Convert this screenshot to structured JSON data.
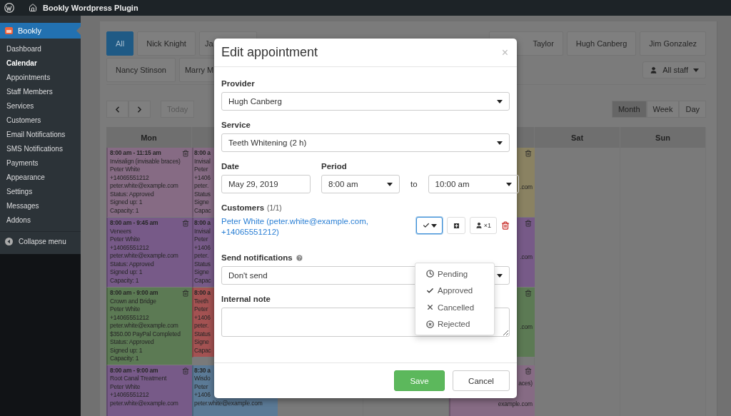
{
  "admin_bar": {
    "title": "Bookly Wordpress Plugin"
  },
  "sidebar": {
    "header": "Bookly",
    "items": [
      {
        "label": "Dashboard",
        "selected": false
      },
      {
        "label": "Calendar",
        "selected": true
      },
      {
        "label": "Appointments",
        "selected": false
      },
      {
        "label": "Staff Members",
        "selected": false
      },
      {
        "label": "Services",
        "selected": false
      },
      {
        "label": "Customers",
        "selected": false
      },
      {
        "label": "Email Notifications",
        "selected": false
      },
      {
        "label": "SMS Notifications",
        "selected": false
      },
      {
        "label": "Payments",
        "selected": false
      },
      {
        "label": "Appearance",
        "selected": false
      },
      {
        "label": "Settings",
        "selected": false
      },
      {
        "label": "Messages",
        "selected": false
      },
      {
        "label": "Addons",
        "selected": false
      }
    ],
    "collapse": "Collapse menu"
  },
  "staff_filter": {
    "rows": [
      {
        "buttons": [
          {
            "label": "All",
            "selected": true,
            "kind": "full"
          },
          {
            "label": "Nick Knight",
            "selected": false,
            "kind": "full"
          },
          {
            "label": "Ja",
            "selected": false,
            "kind": "cut_right"
          },
          {
            "label": "Taylor",
            "selected": false,
            "kind": "cut_left"
          },
          {
            "label": "Hugh Canberg",
            "selected": false,
            "kind": "full"
          },
          {
            "label": "Jim Gonzalez",
            "selected": false,
            "kind": "full"
          }
        ]
      },
      {
        "buttons": [
          {
            "label": "Nancy Stinson",
            "selected": false,
            "kind": "full"
          },
          {
            "label": "Marry M",
            "selected": false,
            "kind": "cut_right"
          }
        ]
      }
    ],
    "all_staff": "All staff"
  },
  "toolbar": {
    "today": "Today",
    "views": [
      {
        "label": "Month",
        "selected": true
      },
      {
        "label": "Week",
        "selected": false
      },
      {
        "label": "Day",
        "selected": false
      }
    ]
  },
  "calendar": {
    "columns": [
      {
        "label": "Mon",
        "events": [
          {
            "kind": "full",
            "color": "#866b84",
            "time": "8:00 am - 11:15 am",
            "lines": [
              "Invisalign (invisable braces)",
              "Peter White",
              "+14065551212",
              "peter.white@example.com",
              "Status: Approved",
              "Signed up: 1",
              "Capacity: 1"
            ]
          },
          {
            "kind": "full",
            "color": "#775a88",
            "time": "8:00 am - 9:45 am",
            "lines": [
              "Veneers",
              "Peter White",
              "+14065551212",
              "peter.white@example.com",
              "Status: Approved",
              "Signed up: 1",
              "Capacity: 1"
            ]
          },
          {
            "kind": "full",
            "color": "#5c7a54",
            "time": "8:00 am - 9:00 am",
            "lines": [
              "Crown and Bridge",
              "Peter White",
              "+14065551212",
              "peter.white@example.com",
              "$350.00 PayPal Completed",
              "Status: Approved",
              "Signed up: 1",
              "Capacity: 1"
            ]
          },
          {
            "kind": "full",
            "color": "#775a88",
            "time": "8:00 am - 9:00 am",
            "lines": [
              "Root Canal Treatment",
              "Peter White",
              "+14065551212",
              "peter.white@example.com"
            ]
          }
        ]
      },
      {
        "events": [
          {
            "kind": "clipped_right",
            "color": "#866b84",
            "time": "8:00 a",
            "lines": [
              "Invisal",
              "Peter",
              "+1406",
              "peter.",
              "Status",
              "Signe",
              "Capac"
            ]
          },
          {
            "kind": "clipped_right",
            "color": "#775a88",
            "time": "8:00 a",
            "lines": [
              "Invisal",
              "Peter",
              "+1406",
              "peter.",
              "Status",
              "Signe",
              "Capac"
            ]
          },
          {
            "kind": "clipped_right",
            "color": "#a35252",
            "time": "8:00 a",
            "lines": [
              "Teeth",
              "Peter",
              "+1406",
              "peter.",
              "Status",
              "Signe",
              "Capac"
            ]
          },
          {
            "kind": "clipped_right",
            "color": "#5b7a96",
            "time": "8:30 a",
            "lines": [
              "Wisdo",
              "Peter",
              "+1406",
              "peter.white@example.com"
            ]
          }
        ]
      },
      {},
      {},
      {
        "events": [
          {
            "kind": "clipped_left",
            "color": "#8a8262",
            "lines": [
              ".com"
            ]
          },
          {
            "kind": "clipped_left",
            "color": "#775a88",
            "lines": [
              ".com"
            ]
          },
          {
            "kind": "clipped_left",
            "color": "#5c7a54",
            "lines": [
              ".com"
            ]
          },
          {
            "kind": "clipped_left_top",
            "color": "#866b84",
            "lines": [
              "aces)",
              "example.com"
            ]
          }
        ]
      },
      {
        "label": "Sat"
      },
      {
        "label": "Sun"
      }
    ]
  },
  "modal": {
    "title": "Edit appointment",
    "close": "×",
    "provider": {
      "label": "Provider",
      "value": "Hugh Canberg"
    },
    "service": {
      "label": "Service",
      "value": "Teeth Whitening (2 h)"
    },
    "date": {
      "label": "Date",
      "value": "May 29, 2019"
    },
    "period": {
      "label": "Period",
      "from": "8:00 am",
      "separator": "to",
      "to": "10:00 am"
    },
    "customers": {
      "label": "Customers",
      "count": "(1/1)",
      "items": [
        {
          "name": "Peter White (peter.white@example.com, +14065551212)",
          "approved": true,
          "seats": "×1"
        }
      ]
    },
    "status_menu": {
      "expanded": true,
      "items": [
        {
          "kind": "pending",
          "label": "Pending"
        },
        {
          "kind": "approved",
          "label": "Approved"
        },
        {
          "kind": "cancelled",
          "label": "Cancelled"
        },
        {
          "kind": "rejected",
          "label": "Rejected"
        }
      ]
    },
    "notifications": {
      "label": "Send notifications",
      "value": "Don't send"
    },
    "internal_note": {
      "label": "Internal note"
    },
    "buttons": [
      {
        "kind": "primary",
        "label": "Save"
      },
      {
        "kind": "default",
        "label": "Cancel"
      }
    ]
  }
}
